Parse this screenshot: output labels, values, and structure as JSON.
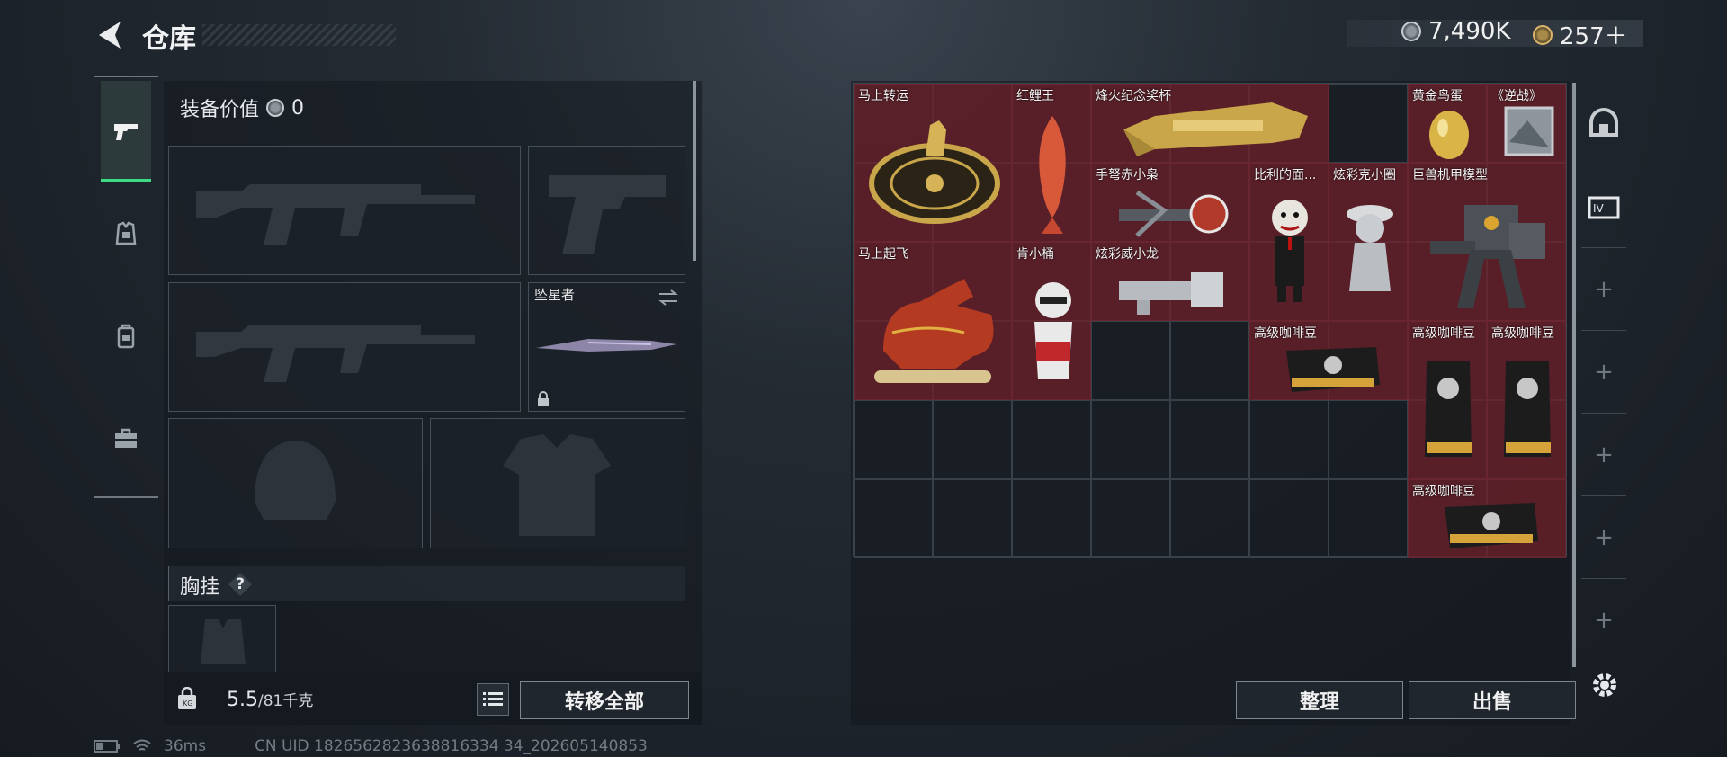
{
  "header": {
    "title": "仓库"
  },
  "currency": {
    "silver": "7,490K",
    "gold": "257＋"
  },
  "equipment": {
    "value_label": "装备价值",
    "value": "0",
    "melee_label": "坠星者",
    "chest_label": "胸挂",
    "help_label": "?",
    "weight_current": "5.5",
    "weight_max": "/81千克",
    "transfer_all_label": "转移全部"
  },
  "stash": {
    "sort_label": "整理",
    "sell_label": "出售",
    "items": [
      {
        "name": "马上转运"
      },
      {
        "name": "红鲤王"
      },
      {
        "name": "烽火纪念奖杯"
      },
      {
        "name": "黄金鸟蛋"
      },
      {
        "name": "《逆战》"
      },
      {
        "name": "手弩赤小枭"
      },
      {
        "name": "比利的面..."
      },
      {
        "name": "炫彩克小圈"
      },
      {
        "name": "巨兽机甲模型"
      },
      {
        "name": "马上起飞"
      },
      {
        "name": "肯小桶"
      },
      {
        "name": "炫彩威小龙"
      },
      {
        "name": "高级咖啡豆"
      },
      {
        "name": "高级咖啡豆"
      },
      {
        "name": "高级咖啡豆"
      },
      {
        "name": "高级咖啡豆"
      }
    ]
  },
  "status": {
    "ping": "36ms",
    "uid": "CN UID 1826562823638816334 34_202605140853"
  },
  "colors": {
    "item_bg": "#6e202a",
    "accent_green": "#3ddc84"
  }
}
